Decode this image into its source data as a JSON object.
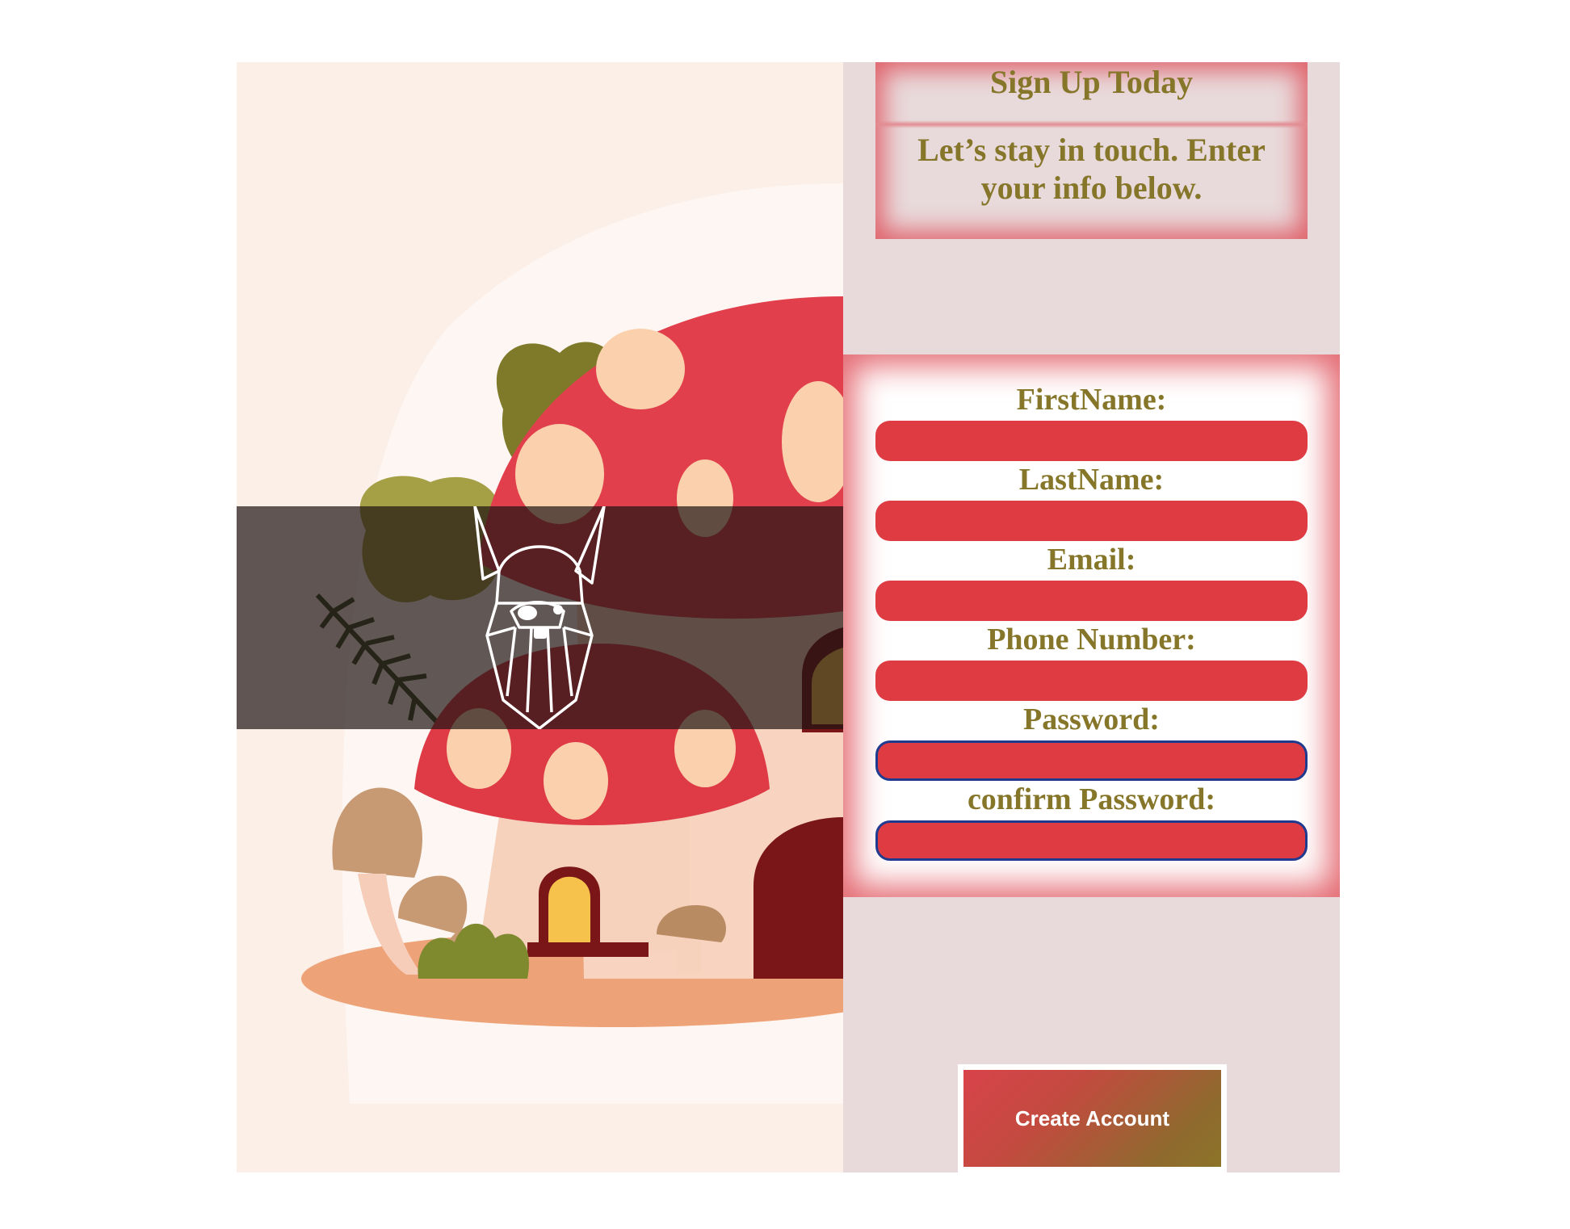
{
  "signup": {
    "title": "Sign Up Today",
    "subtitle": "Let’s stay in touch. Enter your info below."
  },
  "form": {
    "fields": [
      {
        "label": "FirstName:",
        "value": ""
      },
      {
        "label": "LastName:",
        "value": ""
      },
      {
        "label": "Email:",
        "value": ""
      },
      {
        "label": "Phone Number:",
        "value": ""
      },
      {
        "label": "Password:",
        "value": ""
      },
      {
        "label": "confirm Password:",
        "value": ""
      }
    ],
    "submit_label": "Create Account"
  },
  "hero": {
    "illustration": "mushroom-house-illustration",
    "logo": "viking-dwarf-head-icon"
  },
  "colors": {
    "accent_red": "#df3b43",
    "label_olive": "#86762a",
    "panel_bg": "#e8dadb",
    "focus_border": "#1f3a8f"
  }
}
